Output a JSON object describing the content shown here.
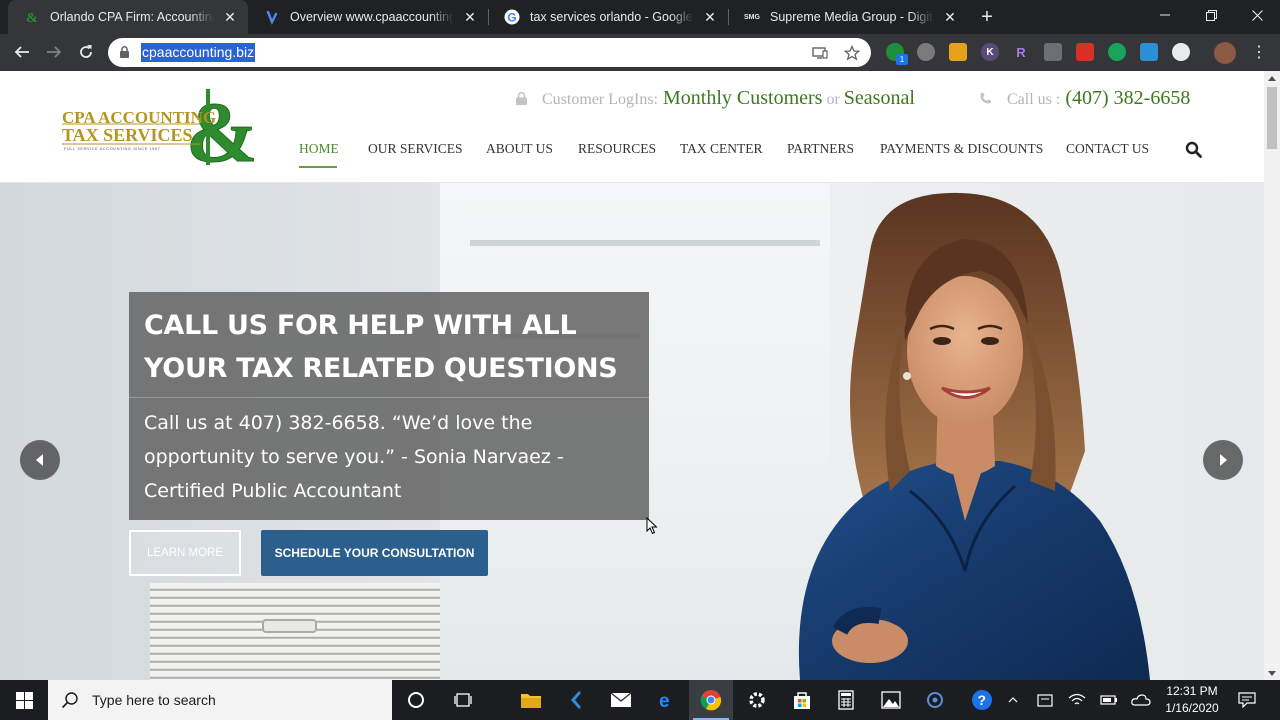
{
  "browser": {
    "tabs": [
      {
        "title": "Orlando CPA Firm: Accounting, Bookkeeping",
        "favicon": "cpa-favicon"
      },
      {
        "title": "Overview www.cpaaccounting.biz",
        "favicon": "seo-tool-favicon"
      },
      {
        "title": "tax services orlando - Google Search",
        "favicon": "google-favicon"
      },
      {
        "title": "Supreme Media Group - Digital Marketing",
        "favicon": "smg-favicon"
      }
    ],
    "smg_label": "SMG",
    "url": "cpaaccounting.biz",
    "extension_badge": "1",
    "colors": {
      "frame": "#202124",
      "toolbar": "#35363a",
      "url_highlight": "#2a63d8"
    }
  },
  "site": {
    "logo": {
      "line1": "CPA ACCOUNTING",
      "line2": "TAX SERVICES",
      "tagline": "FULL SERVICE ACCOUNTING SINCE 1997",
      "ampersand": "&"
    },
    "utility": {
      "login_label": "Customer LogIns:",
      "monthly": "Monthly Customers",
      "or": "or",
      "seasonal": "Seasonal",
      "call_label": "Call us :",
      "phone": "(407) 382-6658"
    },
    "nav": [
      "HOME",
      "OUR SERVICES",
      "ABOUT US",
      "RESOURCES",
      "TAX CENTER",
      "PARTNERS",
      "PAYMENTS & DISCOUNTS",
      "CONTACT US"
    ],
    "hero": {
      "heading": "CALL US FOR HELP WITH ALL YOUR TAX RELATED QUESTIONS",
      "body": "Call us at 407) 382-6658. “We’d love the opportunity to serve you.” - Sonia Narvaez - Certified Public Accountant",
      "learn_more": "LEARN MORE",
      "schedule": "SCHEDULE YOUR CONSULTATION"
    },
    "colors": {
      "accent_green": "#3d7a1f",
      "gold": "#b5951d",
      "schedule_blue": "#2b5f8e"
    }
  },
  "taskbar": {
    "search_placeholder": "Type here to search",
    "time": "12:31 PM",
    "date": "1/16/2020"
  }
}
